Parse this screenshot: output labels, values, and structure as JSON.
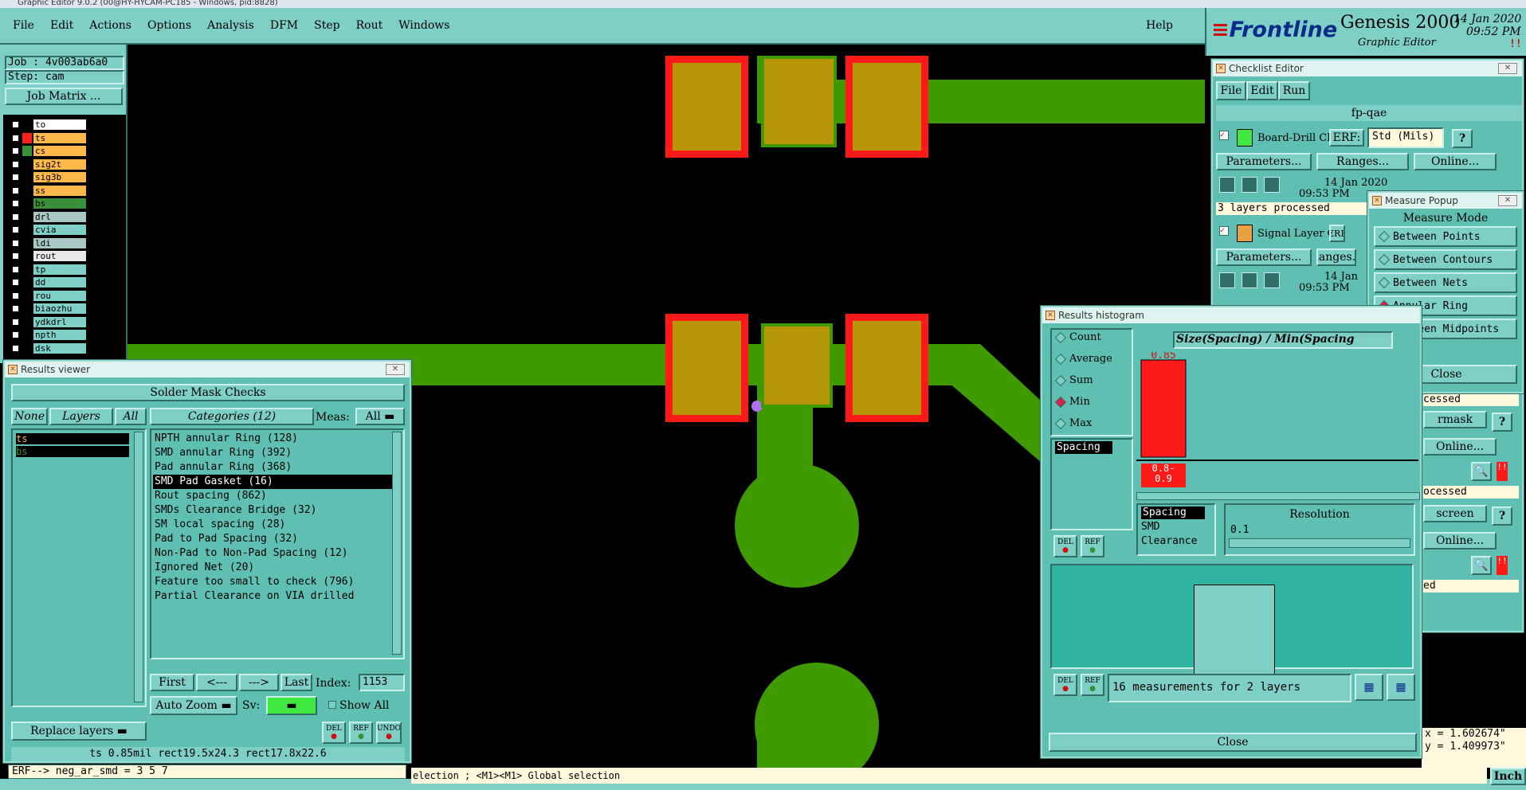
{
  "app": {
    "title": "Graphic Editor 9.0.2 (00@HY-HYCAM-PC185 - Windows, pid:8828)"
  },
  "menubar": {
    "items": [
      "File",
      "Edit",
      "Actions",
      "Options",
      "Analysis",
      "DFM",
      "Step",
      "Rout",
      "Windows"
    ],
    "help": "Help"
  },
  "brand": {
    "logo": "Frontline",
    "product": "Genesis 2000",
    "subtitle": "Graphic Editor",
    "date": "14 Jan 2020",
    "time": "09:52 PM",
    "status": "!!"
  },
  "job": {
    "job": "Job : 4v003ab6a0",
    "step": "Step: cam",
    "matrix_button": "Job Matrix ..."
  },
  "layers": [
    {
      "name": "to",
      "color": "#ffffff",
      "swatch": "#000000",
      "checked": false
    },
    {
      "name": "ts",
      "color": "#ffb84a",
      "swatch": "#ff2020",
      "checked": false
    },
    {
      "name": "cs",
      "color": "#ffb84a",
      "swatch": "#3a8f3a",
      "checked": false,
      "mark": "●"
    },
    {
      "name": "sig2t",
      "color": "#ffb84a",
      "swatch": "#000000",
      "checked": false
    },
    {
      "name": "sig3b",
      "color": "#ffb84a",
      "swatch": "#000000",
      "checked": false
    },
    {
      "name": "ss",
      "color": "#ffb84a",
      "swatch": "#000000",
      "checked": false
    },
    {
      "name": "bs",
      "color": "#3a8f3a",
      "swatch": "#000000",
      "checked": false,
      "mark": "✎"
    },
    {
      "name": "drl",
      "color": "#a9c8c4",
      "swatch": "#000000",
      "checked": false
    },
    {
      "name": "cvia",
      "color": "#7ecfc6",
      "swatch": "#000000",
      "checked": false
    },
    {
      "name": "ldi",
      "color": "#a9c8c4",
      "swatch": "#000000",
      "checked": false
    },
    {
      "name": "rout",
      "color": "#e8e8e8",
      "swatch": "#000000",
      "checked": false
    },
    {
      "name": "tp",
      "color": "#7ecfc6",
      "swatch": "#000000",
      "checked": false
    },
    {
      "name": "dd",
      "color": "#7ecfc6",
      "swatch": "#000000",
      "checked": false,
      "mark": "✎"
    },
    {
      "name": "rou",
      "color": "#7ecfc6",
      "swatch": "#000000",
      "checked": false
    },
    {
      "name": "biaozhu",
      "color": "#7ecfc6",
      "swatch": "#000000",
      "checked": false
    },
    {
      "name": "ydkdrl",
      "color": "#7ecfc6",
      "swatch": "#000000",
      "checked": false
    },
    {
      "name": "npth",
      "color": "#7ecfc6",
      "swatch": "#000000",
      "checked": false
    },
    {
      "name": "dsk",
      "color": "#7ecfc6",
      "swatch": "#000000",
      "checked": false
    }
  ],
  "results_viewer": {
    "title": "Results viewer",
    "header": "Solder Mask Checks",
    "tabs": {
      "none": "None",
      "layers": "Layers",
      "all": "All"
    },
    "categories_label": "Categories (12)",
    "meas_label": "Meas:",
    "meas_value": "All",
    "layer_list": [
      "ts",
      "bs"
    ],
    "categories": [
      "NPTH annular Ring (128)",
      "SMD annular Ring (392)",
      "Pad annular Ring (368)",
      "SMD Pad Gasket (16)",
      "Rout spacing (862)",
      "SMDs Clearance Bridge (32)",
      "SM local spacing (28)",
      "Pad to Pad Spacing (32)",
      "Non-Pad to Non-Pad Spacing (12)",
      "Ignored Net (20)",
      "Feature too small to check (796)",
      "Partial Clearance on VIA drilled"
    ],
    "selected_index": 3,
    "nav": {
      "first": "First",
      "prev": "<---",
      "next": "--->",
      "last": "Last",
      "index_label": "Index:",
      "index_value": "1153"
    },
    "auto_zoom": "Auto Zoom",
    "sv_label": "Sv:",
    "show_all": "Show All",
    "replace_layers": "Replace layers",
    "icons": [
      "DEL",
      "REF",
      "UNDO"
    ],
    "status_line": "ts 0.85mil  rect19.5x24.3  rect17.8x22.6"
  },
  "erf_line": "ERF--> neg_ar_smd = 3 5 7",
  "bottom_hint": "election ; <M1><M1> Global selection",
  "coords": {
    "x": "1.602674\"",
    "y": "1.409973\"",
    "unit": "Inch"
  },
  "checklist": {
    "title": "Checklist Editor",
    "menu": [
      "File",
      "Edit",
      "Run"
    ],
    "name": "fp-qae",
    "rows": [
      {
        "label": "Board-Drill Che",
        "erf": "ERF:",
        "std": "Std (Mils)",
        "date": "14 Jan 2020",
        "time": "09:53 PM",
        "status": "3 layers processed"
      },
      {
        "label": "Signal Layer Ch",
        "erf": "ERF",
        "date": "14 Jan",
        "time": "09:53 PM"
      }
    ],
    "buttons": {
      "parameters": "Parameters...",
      "ranges": "Ranges...",
      "online": "Online..."
    },
    "partial": {
      "processed1": "cessed",
      "mask": "rmask",
      "online2": "Online...",
      "processed2": "ocessed",
      "screen": "screen",
      "online3": "Online...",
      "ed": "ed"
    },
    "help": "?"
  },
  "measure": {
    "title": "Measure Popup",
    "mode_label": "Measure Mode",
    "modes": [
      "Between Points",
      "Between Contours",
      "Between Nets",
      "Annular Ring",
      "Between Midpoints"
    ],
    "selected": 3,
    "close": "Close"
  },
  "histogram": {
    "title": "Results histogram",
    "header": "Size(Spacing) / Min(Spacing",
    "modes": [
      "Count",
      "Average",
      "Sum",
      "Min",
      "Max"
    ],
    "selected": 3,
    "left_list": [
      "Spacing"
    ],
    "bin_list": [
      "Spacing",
      "SMD",
      "Clearance"
    ],
    "resolution_label": "Resolution",
    "resolution_value": "0.1",
    "bar_value": "0.85",
    "bin_label": "0.8-\n0.9",
    "bar_fraction": 1.0,
    "summary": "16 measurements for 2 layers",
    "close": "Close",
    "icons": [
      "DEL",
      "REF"
    ],
    "bar_color": "#ff1a1a"
  }
}
